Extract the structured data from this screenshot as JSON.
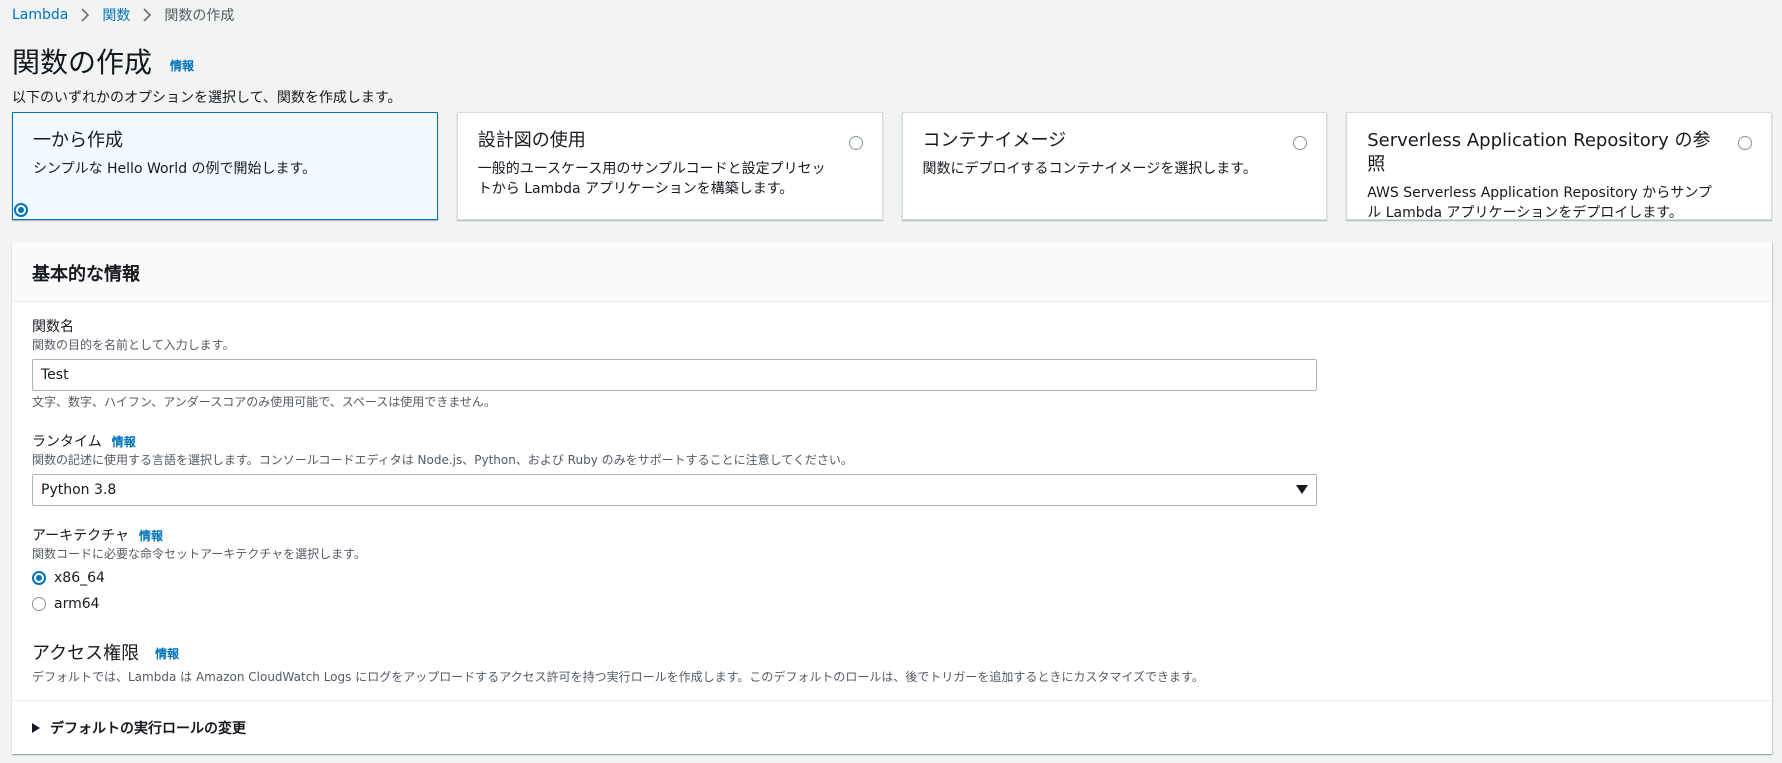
{
  "breadcrumb": {
    "items": [
      "Lambda",
      "関数"
    ],
    "current": "関数の作成"
  },
  "header": {
    "title": "関数の作成",
    "info": "情報",
    "description": "以下のいずれかのオプションを選択して、関数を作成します。"
  },
  "options": [
    {
      "title": "一から作成",
      "description": "シンプルな Hello World の例で開始します。",
      "selected": true
    },
    {
      "title": "設計図の使用",
      "description": "一般的ユースケース用のサンプルコードと設定プリセットから Lambda アプリケーションを構築します。",
      "selected": false
    },
    {
      "title": "コンテナイメージ",
      "description": "関数にデプロイするコンテナイメージを選択します。",
      "selected": false
    },
    {
      "title": "Serverless Application Repository の参照",
      "description": "AWS Serverless Application Repository からサンプル Lambda アプリケーションをデプロイします。",
      "selected": false
    }
  ],
  "basic_info": {
    "title": "基本的な情報",
    "function_name": {
      "label": "関数名",
      "description": "関数の目的を名前として入力します。",
      "value": "Test",
      "constraint": "文字、数字、ハイフン、アンダースコアのみ使用可能で、スペースは使用できません。"
    },
    "runtime": {
      "label": "ランタイム",
      "info": "情報",
      "description": "関数の記述に使用する言語を選択します。コンソールコードエディタは Node.js、Python、および Ruby のみをサポートすることに注意してください。",
      "value": "Python 3.8"
    },
    "architecture": {
      "label": "アーキテクチャ",
      "info": "情報",
      "description": "関数コードに必要な命令セットアーキテクチャを選択します。",
      "options": [
        {
          "label": "x86_64",
          "checked": true
        },
        {
          "label": "arm64",
          "checked": false
        }
      ]
    },
    "permissions": {
      "title": "アクセス権限",
      "info": "情報",
      "description": "デフォルトでは、Lambda は Amazon CloudWatch Logs にログをアップロードするアクセス許可を持つ実行ロールを作成します。このデフォルトのロールは、後でトリガーを追加するときにカスタマイズできます。"
    },
    "expander": {
      "label": "デフォルトの実行ロールの変更"
    }
  },
  "colors": {
    "accent": "#0073bb",
    "background": "#f2f3f3",
    "selected_tile": "#f1faff"
  }
}
